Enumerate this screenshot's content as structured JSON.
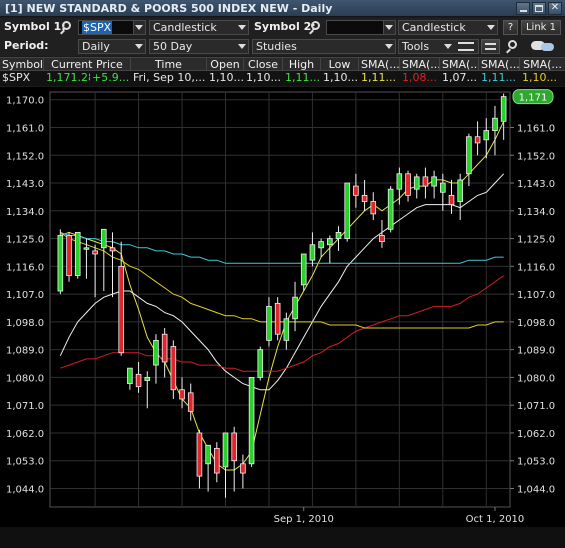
{
  "window": {
    "title": "[1] NEW STANDARD & POORS 500 INDEX NEW - Daily"
  },
  "toolbar1": {
    "symbol1_label": "Symbol 1:",
    "symbol1_value": "$SPX",
    "chart_type1": "Candlestick",
    "symbol2_label": "Symbol 2:",
    "symbol2_value": "",
    "chart_type2": "Candlestick",
    "help_label": "?",
    "link_label": "Link 1"
  },
  "toolbar2": {
    "period_label": "Period:",
    "period_value": "Daily",
    "range_value": "50 Day",
    "studies_value": "Studies",
    "tools_value": "Tools"
  },
  "quote_table": {
    "headers": [
      "Symbol",
      "Current Price",
      "Time",
      "Open",
      "Close",
      "High",
      "Low",
      "SMA(...",
      "SMA(...",
      "SMA(...",
      "SMA(...",
      "SMA(..."
    ],
    "row": [
      "$SPX",
      "1,171.28",
      "+5.9...",
      "Fri, Sep 10,...",
      "1,10...",
      "1,10...",
      "1,11...",
      "1,10...",
      "1,11...",
      "1,08...",
      "1,07...",
      "1,11...",
      "1,10..."
    ]
  },
  "colors": {
    "up": "#27d22a",
    "down": "#e0262c",
    "sma_yellow": "#e8e24a",
    "sma_white": "#f0f0f0",
    "sma_red": "#d02020",
    "sma_cyan": "#40c8d8",
    "sma_olive": "#e0d020",
    "grid": "#303030",
    "change_green": "#40e040"
  },
  "chart_data": {
    "type": "candlestick",
    "symbol": "$SPX",
    "period": "Daily",
    "y_ticks": [
      "1,170.0",
      "1,161.0",
      "1,152.0",
      "1,143.0",
      "1,134.0",
      "1,125.0",
      "1,116.0",
      "1,107.0",
      "1,098.0",
      "1,089.0",
      "1,080.0",
      "1,071.0",
      "1,062.0",
      "1,053.0",
      "1,044.0"
    ],
    "y_tick_values": [
      1170,
      1161,
      1152,
      1143,
      1134,
      1125,
      1116,
      1107,
      1098,
      1089,
      1080,
      1071,
      1062,
      1053,
      1044
    ],
    "right_ticks": [
      "1,161.0",
      "1,152.0",
      "1,143.0",
      "1,134.0",
      "1,125.0",
      "1,116.0",
      "1,107.0",
      "1,098.0",
      "1,089.0",
      "1,080.0",
      "1,071.0",
      "1,062.0",
      "1,053.0",
      "1,044.0"
    ],
    "right_tick_values": [
      1161,
      1152,
      1143,
      1134,
      1125,
      1116,
      1107,
      1098,
      1089,
      1080,
      1071,
      1062,
      1053,
      1044
    ],
    "ylim": [
      1038,
      1172.5
    ],
    "last_price_label": "1,171",
    "last_price_value": 1171,
    "x_labels": [
      {
        "text": "Sep 1, 2010",
        "index": 28
      },
      {
        "text": "Oct 1, 2010",
        "index": 50
      }
    ],
    "grid": true,
    "candles": [
      [
        1108,
        1128,
        1107,
        1126
      ],
      [
        1126,
        1127,
        1111,
        1113
      ],
      [
        1113,
        1127,
        1112,
        1127
      ],
      [
        1122,
        1125,
        1112,
        1122
      ],
      [
        1121,
        1123,
        1106,
        1120
      ],
      [
        1122,
        1128,
        1108,
        1128
      ],
      [
        1122,
        1127,
        1106,
        1121
      ],
      [
        1116,
        1124,
        1087,
        1088
      ],
      [
        1078,
        1083,
        1076,
        1083
      ],
      [
        1081,
        1085,
        1075,
        1077
      ],
      [
        1079,
        1082,
        1070,
        1080
      ],
      [
        1084,
        1094,
        1078,
        1092
      ],
      [
        1094,
        1096,
        1080,
        1085
      ],
      [
        1090,
        1092,
        1073,
        1076
      ],
      [
        1076,
        1080,
        1070,
        1073
      ],
      [
        1075,
        1078,
        1066,
        1069
      ],
      [
        1062,
        1063,
        1044,
        1048
      ],
      [
        1052,
        1058,
        1043,
        1058
      ],
      [
        1057,
        1059,
        1046,
        1049
      ],
      [
        1051,
        1062,
        1041,
        1062
      ],
      [
        1062,
        1064,
        1043,
        1053
      ],
      [
        1052,
        1055,
        1044,
        1049
      ],
      [
        1052,
        1080,
        1051,
        1080
      ],
      [
        1080,
        1090,
        1079,
        1089
      ],
      [
        1092,
        1106,
        1090,
        1103
      ],
      [
        1104,
        1106,
        1092,
        1094
      ],
      [
        1092,
        1101,
        1089,
        1099
      ],
      [
        1099,
        1111,
        1095,
        1106
      ],
      [
        1110,
        1120,
        1108,
        1120
      ],
      [
        1118,
        1127,
        1116,
        1123
      ],
      [
        1122,
        1125,
        1119,
        1124
      ],
      [
        1123,
        1126,
        1117,
        1125
      ],
      [
        1125,
        1129,
        1121,
        1127
      ],
      [
        1125,
        1143,
        1124,
        1143
      ],
      [
        1142,
        1146,
        1135,
        1139
      ],
      [
        1139,
        1144,
        1134,
        1137
      ],
      [
        1137,
        1140,
        1131,
        1133
      ],
      [
        1126,
        1131,
        1122,
        1124
      ],
      [
        1128,
        1142,
        1127,
        1141
      ],
      [
        1141,
        1148,
        1136,
        1146
      ],
      [
        1146,
        1147,
        1137,
        1139
      ],
      [
        1141,
        1146,
        1138,
        1145
      ],
      [
        1145,
        1148,
        1138,
        1142
      ],
      [
        1142,
        1147,
        1138,
        1145
      ],
      [
        1140,
        1146,
        1134,
        1143
      ],
      [
        1139,
        1144,
        1133,
        1136
      ],
      [
        1137,
        1146,
        1131,
        1144
      ],
      [
        1146,
        1159,
        1142,
        1158
      ],
      [
        1158,
        1163,
        1152,
        1156
      ],
      [
        1157,
        1164,
        1151,
        1160
      ],
      [
        1160,
        1168,
        1152,
        1164
      ],
      [
        1163,
        1172,
        1157,
        1171
      ]
    ],
    "series": [
      {
        "type": "line",
        "values": [
          1126,
          1127,
          1126,
          1125,
          1124,
          1123,
          1122,
          1120,
          1110,
          1102,
          1093,
          1088,
          1085,
          1079,
          1073,
          1070,
          1062,
          1057,
          1052,
          1050,
          1050,
          1052,
          1056,
          1068,
          1080,
          1090,
          1098,
          1103,
          1108,
          1113,
          1119,
          1122,
          1125,
          1128,
          1131,
          1134,
          1136,
          1134,
          1136,
          1138,
          1141,
          1142,
          1142,
          1144,
          1144,
          1143,
          1143,
          1146,
          1149,
          1152,
          1157,
          1163
        ]
      },
      {
        "type": "line",
        "values": [
          1087,
          1093,
          1098,
          1101,
          1104,
          1106,
          1107,
          1108,
          1108,
          1106,
          1104,
          1103,
          1101,
          1100,
          1098,
          1095,
          1092,
          1089,
          1085,
          1082,
          1080,
          1078,
          1077,
          1076,
          1076,
          1079,
          1083,
          1088,
          1093,
          1098,
          1103,
          1107,
          1111,
          1116,
          1119,
          1122,
          1125,
          1127,
          1129,
          1131,
          1133,
          1135,
          1136,
          1136,
          1136,
          1136,
          1135,
          1137,
          1139,
          1140,
          1143,
          1146
        ]
      },
      {
        "type": "line",
        "values": [
          1083,
          1084,
          1085,
          1086,
          1086,
          1087,
          1088,
          1088,
          1088,
          1088,
          1087,
          1087,
          1086,
          1086,
          1085,
          1085,
          1084,
          1084,
          1084,
          1083,
          1083,
          1082,
          1082,
          1082,
          1082,
          1082,
          1083,
          1084,
          1085,
          1087,
          1088,
          1090,
          1091,
          1093,
          1095,
          1096,
          1097,
          1098,
          1099,
          1100,
          1100,
          1101,
          1102,
          1103,
          1103,
          1103,
          1104,
          1106,
          1107,
          1109,
          1111,
          1113
        ]
      },
      {
        "type": "line",
        "values": [
          1127,
          1126,
          1126,
          1125,
          1125,
          1124,
          1124,
          1123,
          1123,
          1122,
          1122,
          1121,
          1121,
          1120,
          1120,
          1119,
          1119,
          1118,
          1118,
          1117,
          1117,
          1117,
          1117,
          1117,
          1117,
          1117,
          1117,
          1117,
          1117,
          1117,
          1117,
          1117,
          1117,
          1117,
          1117,
          1117,
          1117,
          1117,
          1117,
          1117,
          1117,
          1117,
          1117,
          1117,
          1117,
          1117,
          1117,
          1118,
          1118,
          1118,
          1119,
          1119
        ]
      },
      {
        "type": "line",
        "values": [
          1127,
          1125,
          1124,
          1123,
          1122,
          1121,
          1119,
          1118,
          1116,
          1115,
          1113,
          1111,
          1109,
          1107,
          1106,
          1104,
          1103,
          1102,
          1101,
          1100,
          1100,
          1099,
          1099,
          1098,
          1098,
          1098,
          1098,
          1098,
          1098,
          1098,
          1098,
          1097,
          1097,
          1097,
          1097,
          1096,
          1096,
          1096,
          1096,
          1096,
          1096,
          1096,
          1096,
          1096,
          1096,
          1096,
          1096,
          1096,
          1097,
          1097,
          1098,
          1098
        ]
      }
    ]
  }
}
